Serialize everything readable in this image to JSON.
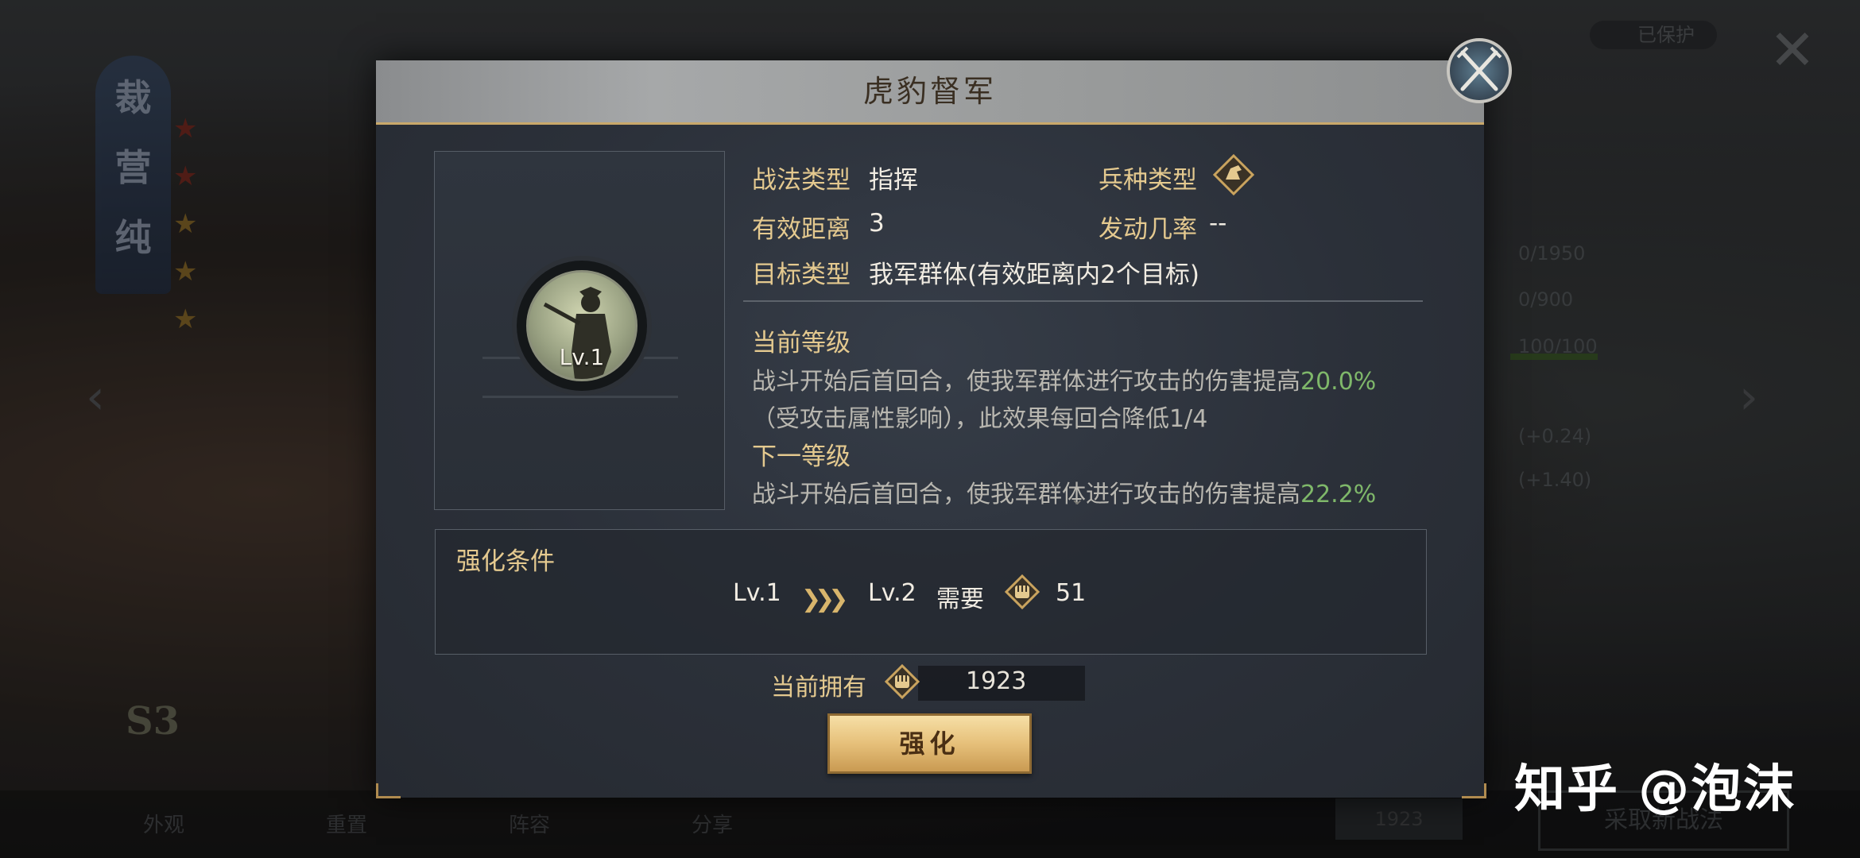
{
  "background": {
    "banner_chars": [
      "裁",
      "营",
      "纯"
    ],
    "grade_badge": "S3",
    "top_right_label": "已保护",
    "stats": [
      "0/1950",
      "0/900",
      "100/100",
      "(+0.24)",
      "(+1.40)"
    ],
    "bottom_menu": [
      "外观",
      "重置",
      "阵容",
      "分享"
    ],
    "bottom_currency": "1923",
    "bottom_button": "采取新战法"
  },
  "modal": {
    "title": "虎豹督军",
    "portrait": {
      "level": "Lv.1"
    },
    "info": {
      "tactic_type_label": "战法类型",
      "tactic_type_value": "指挥",
      "troop_type_label": "兵种类型",
      "range_label": "有效距离",
      "range_value": "3",
      "trigger_rate_label": "发动几率",
      "trigger_rate_value": "--",
      "target_label": "目标类型",
      "target_value": "我军群体(有效距离内2个目标)"
    },
    "current_level": {
      "title": "当前等级",
      "line1_prefix": "战斗开始后首回合，使我军群体进行攻击的伤害提高",
      "line1_value": "20.0%",
      "line2": "（受攻击属性影响），此效果每回合降低1/4"
    },
    "next_level": {
      "title": "下一等级",
      "line1_prefix": "战斗开始后首回合，使我军群体进行攻击的伤害提高",
      "line1_value": "22.2%"
    },
    "upgrade_conditions": {
      "title": "强化条件",
      "from_level": "Lv.1",
      "to_level": "Lv.2",
      "need_label": "需要",
      "need_amount": "51"
    },
    "owned": {
      "label": "当前拥有",
      "amount": "1923"
    },
    "upgrade_button": "强化"
  },
  "watermark": "知乎 @泡沫",
  "colors": {
    "gold_label": "#e4c98f",
    "highlight_green": "#7fb86a",
    "button_gold": "#e6c07a"
  }
}
